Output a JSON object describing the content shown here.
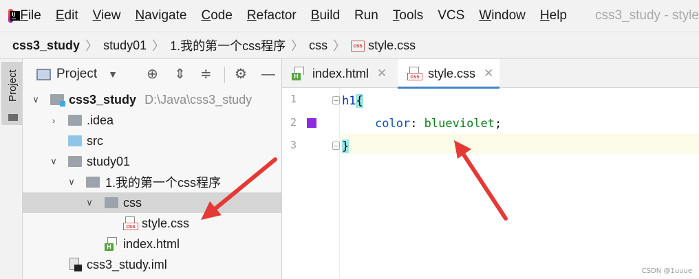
{
  "menubar": {
    "app_icon_text": "IJ",
    "items": [
      "File",
      "Edit",
      "View",
      "Navigate",
      "Code",
      "Refactor",
      "Build",
      "Run",
      "Tools",
      "VCS",
      "Window",
      "Help"
    ],
    "window_title": "css3_study - style"
  },
  "breadcrumb": {
    "items": [
      "css3_study",
      "study01",
      "1.我的第一个css程序",
      "css",
      "style.css"
    ],
    "file_icon": "css-file-icon"
  },
  "stripe": {
    "project_label": "Project"
  },
  "project_panel": {
    "title": "Project",
    "view_selector_icon": "chevron-down-icon",
    "toolbar_icons": [
      "locate-icon",
      "expand-all-icon",
      "collapse-all-icon",
      "gear-icon",
      "minimize-icon"
    ],
    "tree": [
      {
        "label": "css3_study",
        "path": "D:\\Java\\css3_study",
        "type": "module-folder",
        "expanded": true,
        "depth": 0
      },
      {
        "label": ".idea",
        "type": "folder",
        "expanded": false,
        "depth": 1
      },
      {
        "label": "src",
        "type": "source-folder",
        "depth": 1
      },
      {
        "label": "study01",
        "type": "folder",
        "expanded": true,
        "depth": 1
      },
      {
        "label": "1.我的第一个css程序",
        "type": "folder",
        "expanded": true,
        "depth": 2
      },
      {
        "label": "css",
        "type": "folder",
        "expanded": true,
        "depth": 3,
        "selected": true
      },
      {
        "label": "style.css",
        "type": "css-file",
        "depth": 4
      },
      {
        "label": "index.html",
        "type": "html-file",
        "depth": 3
      },
      {
        "label": "css3_study.iml",
        "type": "iml-file",
        "depth": 1
      }
    ]
  },
  "editor": {
    "tabs": [
      {
        "label": "index.html",
        "icon": "html-file-icon",
        "active": false
      },
      {
        "label": "style.css",
        "icon": "css-file-icon",
        "active": true
      }
    ],
    "line_numbers": [
      "1",
      "2",
      "3"
    ],
    "code": {
      "selector": "h1",
      "open_brace": "{",
      "property": "color",
      "colon": ": ",
      "value": "blueviolet",
      "semicolon": ";",
      "close_brace": "}"
    },
    "swatch_color": "#8a2be2"
  },
  "watermark": "CSDN @1uuue",
  "colors": {
    "accent": "#4083c9",
    "annotation_arrow": "#e53935",
    "css_value": "#067d17",
    "selector": "#0033b3"
  }
}
